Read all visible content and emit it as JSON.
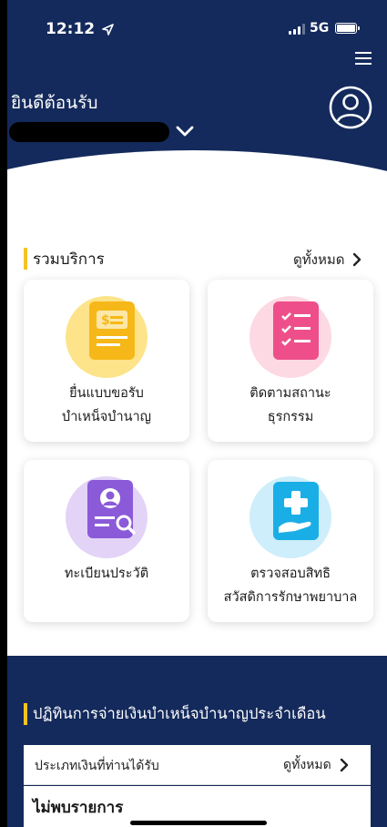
{
  "status_bar": {
    "time": "12:12",
    "network": "5G",
    "location_icon": "location-arrow-icon",
    "signal_icon": "signal-bars-icon",
    "battery_icon": "battery-icon"
  },
  "header": {
    "welcome": "ยินดีต้อนรับ",
    "menu_icon": "hamburger-menu-icon",
    "profile_icon": "user-profile-icon",
    "dropdown_icon": "chevron-down-icon",
    "background_color": "#142a5c"
  },
  "services": {
    "title": "รวมบริการ",
    "see_all": "ดูทั้งหมด",
    "accent_color": "#f6c324",
    "items": [
      {
        "line1": "ยื่นแบบขอรับ",
        "line2": "บำเหน็จบำนาญ",
        "icon": "money-document-icon"
      },
      {
        "line1": "ติดตามสถานะ",
        "line2": "ธุรกรรม",
        "icon": "checklist-icon"
      },
      {
        "line1": "ทะเบียนประวัติ",
        "line2": "",
        "icon": "profile-search-icon"
      },
      {
        "line1": "ตรวจสอบสิทธิ",
        "line2": "สวัสดิการรักษาพยาบาล",
        "icon": "medical-care-icon"
      }
    ]
  },
  "pension_calendar": {
    "title": "ปฏิทินการจ่ายเงินบำเหน็จบำนาญประจำเดือน",
    "filter_label": "ประเภทเงินที่ท่านได้รับ",
    "see_all": "ดูทั้งหมด",
    "empty_text": "ไม่พบรายการ"
  }
}
